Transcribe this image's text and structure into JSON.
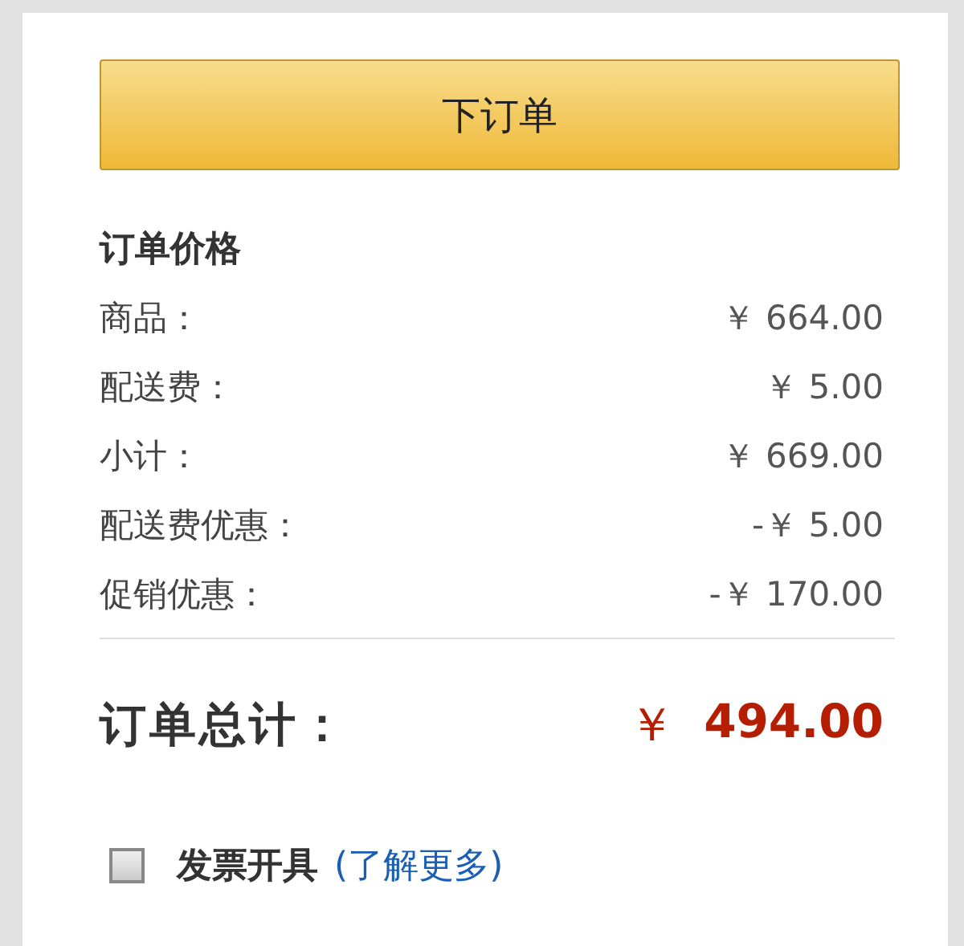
{
  "order_button": "下订单",
  "price_section": {
    "title": "订单价格",
    "rows": [
      {
        "label": "商品：",
        "value": "￥ 664.00"
      },
      {
        "label": "配送费：",
        "value": "￥ 5.00"
      },
      {
        "label": "小计：",
        "value": "￥ 669.00"
      },
      {
        "label": "配送费优惠：",
        "value": "-￥ 5.00"
      },
      {
        "label": "促销优惠：",
        "value": "-￥ 170.00"
      }
    ]
  },
  "total": {
    "label": "订单总计：",
    "currency": "￥",
    "amount": "494.00"
  },
  "invoice": {
    "label": "发票开具",
    "checked": false,
    "link": "(了解更多)"
  }
}
